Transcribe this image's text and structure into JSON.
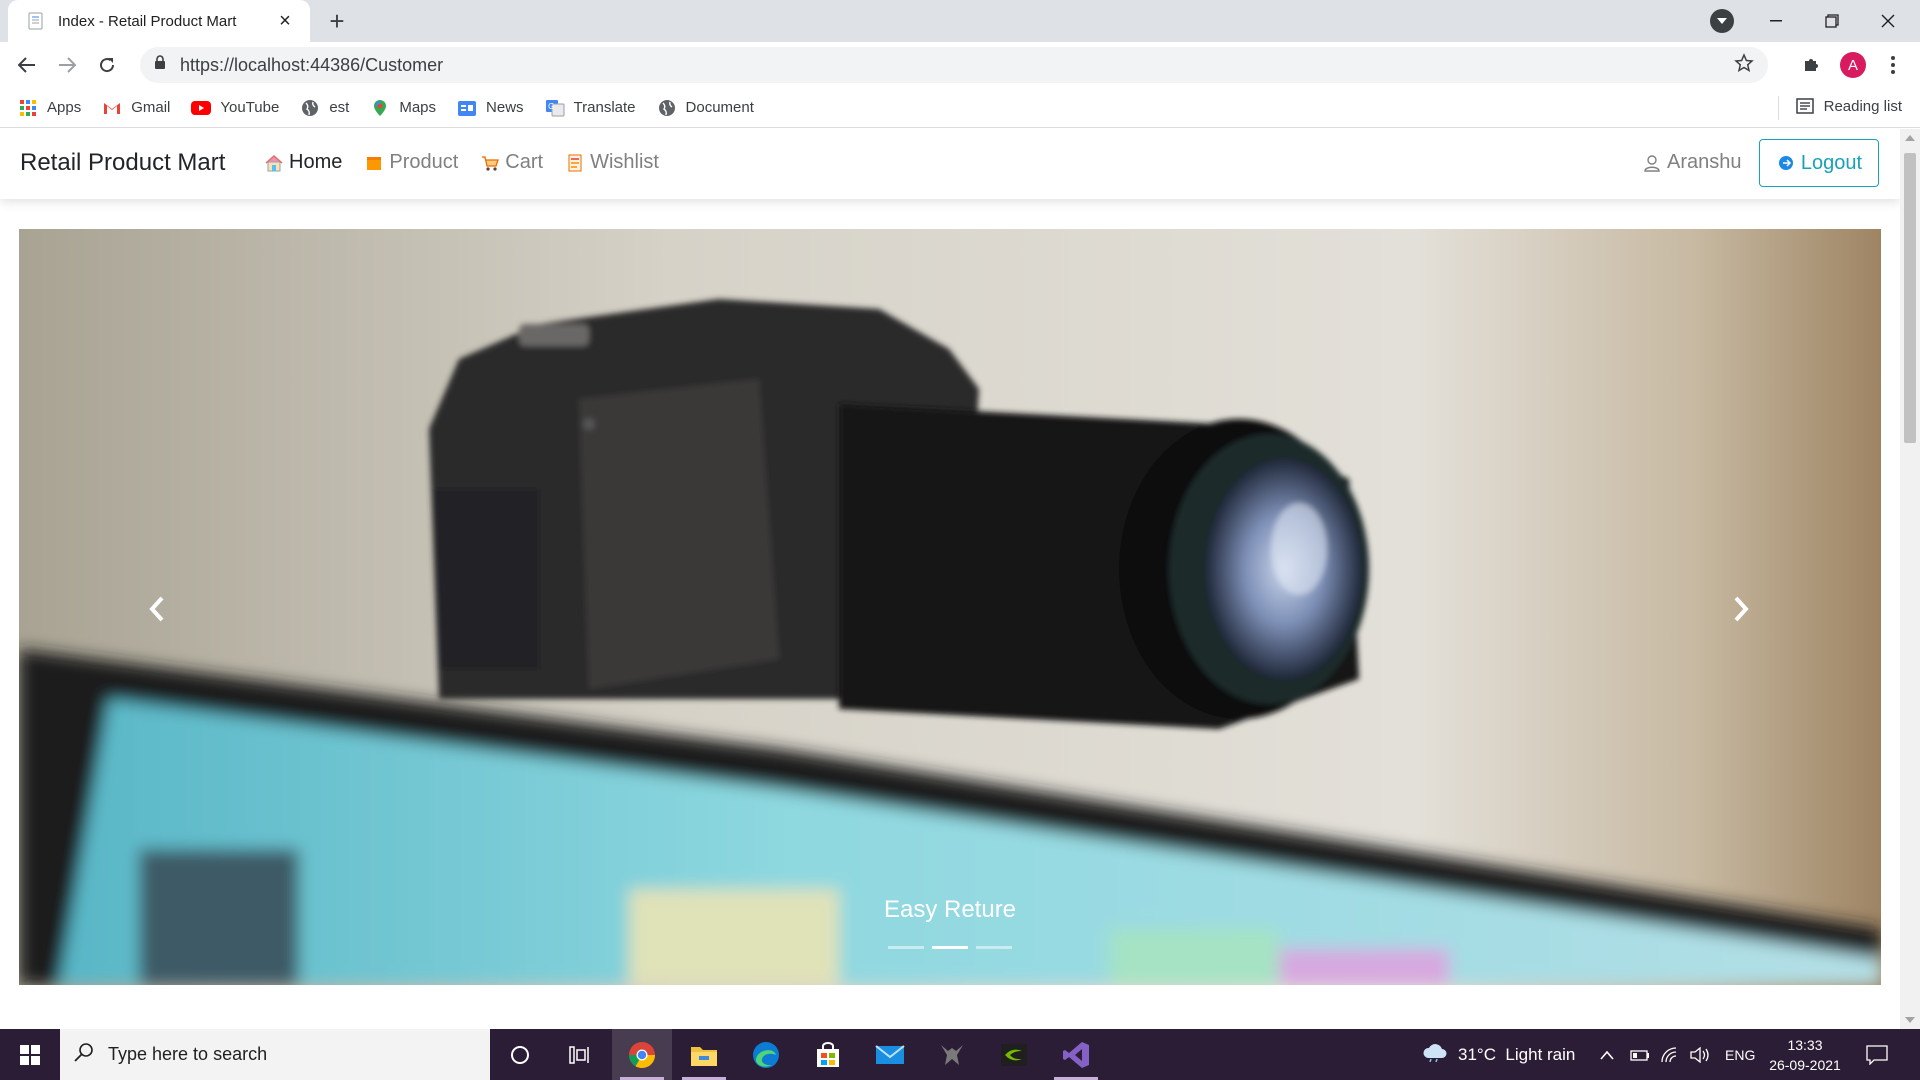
{
  "browser": {
    "tab_title": "Index - Retail Product Mart",
    "url": "https://localhost:44386/Customer",
    "profile_initial": "A",
    "bookmarks": [
      {
        "label": "Apps",
        "icon": "apps-grid-icon"
      },
      {
        "label": "Gmail",
        "icon": "gmail-icon"
      },
      {
        "label": "YouTube",
        "icon": "youtube-icon"
      },
      {
        "label": "est",
        "icon": "globe-icon"
      },
      {
        "label": "Maps",
        "icon": "maps-icon"
      },
      {
        "label": "News",
        "icon": "news-icon"
      },
      {
        "label": "Translate",
        "icon": "translate-icon"
      },
      {
        "label": "Document",
        "icon": "globe-icon"
      }
    ],
    "reading_list": "Reading list"
  },
  "site": {
    "brand": "Retail Product Mart",
    "nav": [
      {
        "label": "Home",
        "icon": "home-icon",
        "active": true
      },
      {
        "label": "Product",
        "icon": "product-icon",
        "active": false
      },
      {
        "label": "Cart",
        "icon": "cart-icon",
        "active": false
      },
      {
        "label": "Wishlist",
        "icon": "wishlist-icon",
        "active": false
      }
    ],
    "user": "Aranshu",
    "logout": "Logout",
    "accent_color": "#17a2b8"
  },
  "carousel": {
    "caption": "Easy Reture",
    "slide_count": 3,
    "active_index": 1
  },
  "taskbar": {
    "search_placeholder": "Type here to search",
    "weather": "31°C  Light rain",
    "language": "ENG",
    "time": "13:33",
    "date": "26-09-2021"
  }
}
